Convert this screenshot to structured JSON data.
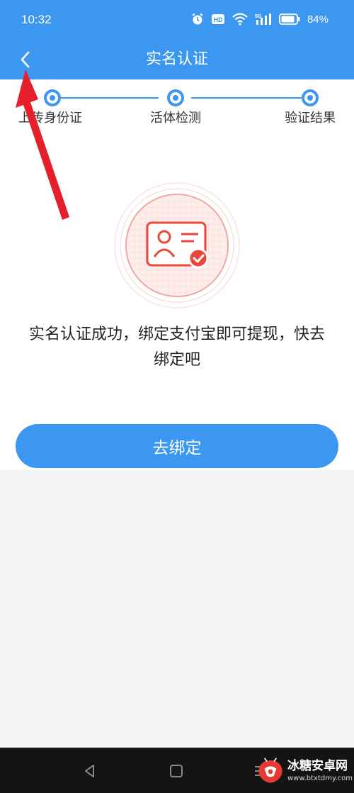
{
  "status_bar": {
    "time": "10:32",
    "battery_percent": "84%",
    "network_label": "5G",
    "hd_label": "HD",
    "icons": [
      "alarm-icon",
      "hd-icon",
      "wifi-icon",
      "signal-icon",
      "battery-icon"
    ]
  },
  "nav": {
    "title": "实名认证",
    "back_icon": "chevron-left-icon"
  },
  "stepper": {
    "steps": [
      {
        "label": "上传身份证"
      },
      {
        "label": "活体检测"
      },
      {
        "label": "验证结果"
      }
    ],
    "accent_color": "#3b97ef"
  },
  "content": {
    "illustration": "id-card-verified-icon",
    "message": "实名认证成功，绑定支付宝即可提现，快去绑定吧",
    "bind_button_label": "去绑定"
  },
  "system_nav": {
    "icons": [
      "nav-back-icon",
      "nav-home-icon",
      "nav-recent-icon"
    ]
  },
  "watermark": {
    "name": "冰糖安卓网",
    "url": "www.btxtdmy.com"
  },
  "colors": {
    "primary": "#3b97ef",
    "illustration_red": "#e8473a",
    "annotation_red": "#e5202a"
  }
}
